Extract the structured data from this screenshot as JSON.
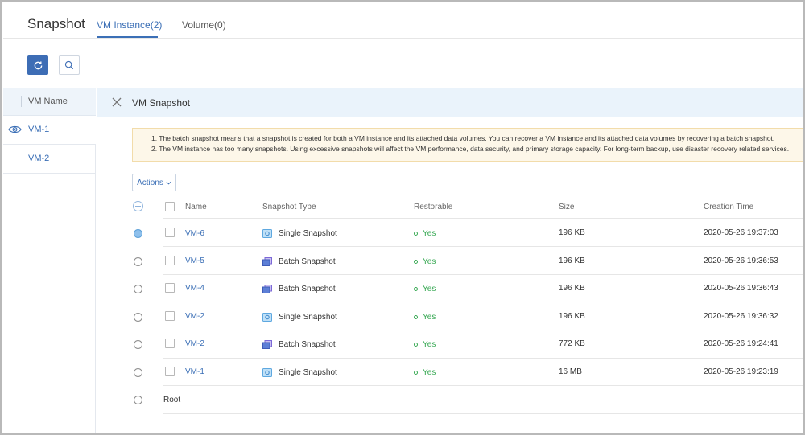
{
  "header": {
    "title": "Snapshot",
    "tabs": [
      {
        "label": "VM Instance(2)",
        "active": true
      },
      {
        "label": "Volume(0)",
        "active": false
      }
    ]
  },
  "toolbar": {
    "refresh_icon": "refresh-icon",
    "search_icon": "search-icon",
    "accent_color": "#3d6db5"
  },
  "left_panel": {
    "column_header": "VM Name",
    "items": [
      {
        "label": "VM-1",
        "selected": true
      },
      {
        "label": "VM-2",
        "selected": false
      }
    ]
  },
  "detail": {
    "title": "VM Snapshot",
    "notice": [
      "1. The batch snapshot means that a snapshot is created for both a VM instance and its attached data volumes. You can recover a VM instance and its attached data volumes by recovering a batch snapshot.",
      "2. The VM instance has too many snapshots. Using excessive snapshots will affect the VM performance, data security, and primary storage capacity. For long-term backup, use disaster recovery related services."
    ],
    "actions_label": "Actions"
  },
  "table": {
    "columns": [
      "Name",
      "Snapshot Type",
      "Restorable",
      "Size",
      "Creation Time"
    ],
    "rows": [
      {
        "name": "VM-6",
        "type": "Single Snapshot",
        "type_icon": "single-snapshot-icon",
        "restorable": "Yes",
        "size": "196 KB",
        "created": "2020-05-26 19:37:03",
        "current": true
      },
      {
        "name": "VM-5",
        "type": "Batch Snapshot",
        "type_icon": "batch-snapshot-icon",
        "restorable": "Yes",
        "size": "196 KB",
        "created": "2020-05-26 19:36:53",
        "current": false
      },
      {
        "name": "VM-4",
        "type": "Batch Snapshot",
        "type_icon": "batch-snapshot-icon",
        "restorable": "Yes",
        "size": "196 KB",
        "created": "2020-05-26 19:36:43",
        "current": false
      },
      {
        "name": "VM-2",
        "type": "Single Snapshot",
        "type_icon": "single-snapshot-icon",
        "restorable": "Yes",
        "size": "196 KB",
        "created": "2020-05-26 19:36:32",
        "current": false
      },
      {
        "name": "VM-2",
        "type": "Batch Snapshot",
        "type_icon": "batch-snapshot-icon",
        "restorable": "Yes",
        "size": "772 KB",
        "created": "2020-05-26 19:24:41",
        "current": false
      },
      {
        "name": "VM-1",
        "type": "Single Snapshot",
        "type_icon": "single-snapshot-icon",
        "restorable": "Yes",
        "size": "16 MB",
        "created": "2020-05-26 19:23:19",
        "current": false
      }
    ],
    "root_label": "Root"
  }
}
